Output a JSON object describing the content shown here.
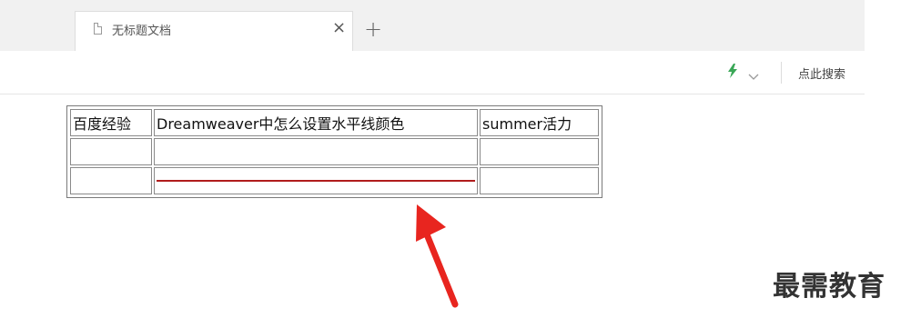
{
  "tab": {
    "title": "无标题文档",
    "close_glyph": "×",
    "new_tab_glyph": "+",
    "doc_icon": "document-icon"
  },
  "toolbar": {
    "bolt_icon": "lightning-icon",
    "bolt_color": "#3aa757",
    "chevron_icon": "chevron-down-icon",
    "search_label": "点此搜索"
  },
  "table": {
    "rows": [
      [
        "百度经验",
        "Dreamweaver中怎么设置水平线颜色",
        "summer活力"
      ],
      [
        "",
        "",
        ""
      ],
      [
        "",
        "",
        ""
      ]
    ],
    "hr_color": "#b01c1c"
  },
  "annotation": {
    "arrow_color": "#e8251f"
  },
  "watermark": {
    "text": "最需教育"
  }
}
